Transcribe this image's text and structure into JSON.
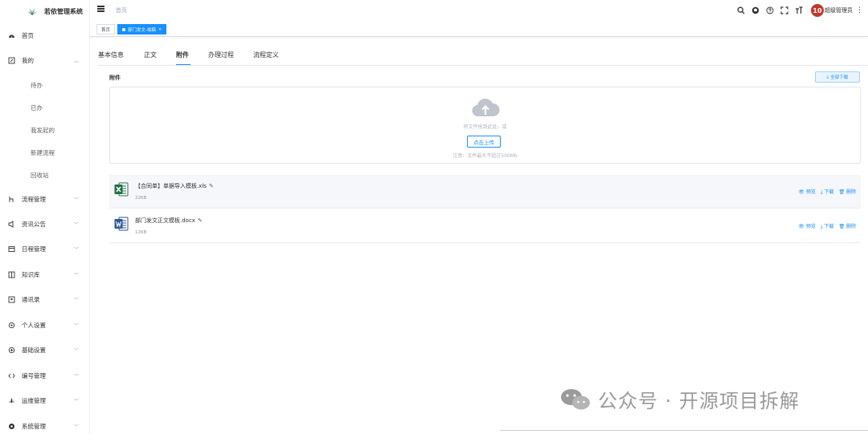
{
  "app": {
    "title": "若依管理系统"
  },
  "header": {
    "breadcrumb": "首页",
    "user_name": "超级管理员",
    "avatar_text": "10",
    "icons": [
      "search-icon",
      "github-icon",
      "help-icon",
      "fullscreen-icon",
      "font-size-icon"
    ]
  },
  "sidebar": {
    "items": [
      {
        "label": "首页",
        "icon": "dashboard-icon"
      },
      {
        "label": "我的",
        "icon": "edit-icon",
        "expanded": true
      },
      {
        "label": "待办"
      },
      {
        "label": "已办"
      },
      {
        "label": "我发起的"
      },
      {
        "label": "新建流程"
      },
      {
        "label": "回收站"
      },
      {
        "label": "流程管理",
        "icon": "flow-icon"
      },
      {
        "label": "资讯公告",
        "icon": "sound-icon"
      },
      {
        "label": "日程管理",
        "icon": "calendar-icon"
      },
      {
        "label": "知识库",
        "icon": "book-icon"
      },
      {
        "label": "通讯录",
        "icon": "contacts-icon"
      },
      {
        "label": "个人设置",
        "icon": "setting-icon"
      },
      {
        "label": "基础设置",
        "icon": "base-icon"
      },
      {
        "label": "编号管理",
        "icon": "code-icon"
      },
      {
        "label": "运维管理",
        "icon": "ops-icon"
      },
      {
        "label": "系统管理",
        "icon": "system-icon"
      }
    ]
  },
  "tags": {
    "home": "首页",
    "active": "部门发文-拟稿"
  },
  "tabs": [
    {
      "label": "基本信息"
    },
    {
      "label": "正文"
    },
    {
      "label": "附件",
      "active": true
    },
    {
      "label": "办理过程"
    },
    {
      "label": "流程定义"
    }
  ],
  "attachment": {
    "title": "附件",
    "download_all": "全部下载",
    "drop_hint": "将文件拖到此处，或",
    "upload_button": "点击上传",
    "note": "注意：文件最大不超过500Mb",
    "files": [
      {
        "name": "【合同单】单据导入模板.xls",
        "size": "22KB",
        "type": "excel"
      },
      {
        "name": "部门发文正文模板.docx",
        "size": "12KB",
        "type": "word"
      }
    ],
    "actions": {
      "preview": "预览",
      "download": "下载",
      "delete": "删除"
    }
  },
  "watermark": {
    "text": "公众号 · 开源项目拆解"
  },
  "colors": {
    "primary": "#1890ff",
    "excel": "#1d7044",
    "word": "#2b579a",
    "avatar": "#c0392b"
  }
}
